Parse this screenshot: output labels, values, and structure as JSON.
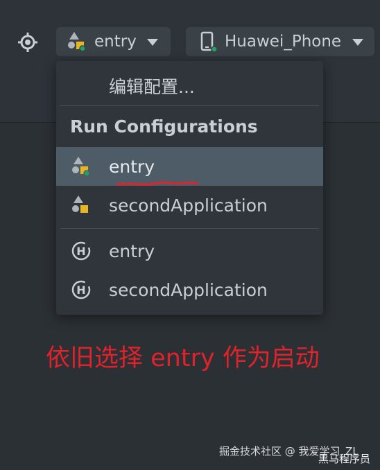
{
  "toolbar": {
    "target_icon": "crosshair-icon",
    "module_select": {
      "icon": "module-icon",
      "value": "entry",
      "caret": "caret-down-icon"
    },
    "device_select": {
      "icon": "phone-icon",
      "value": "Huawei_Phone",
      "caret": "caret-down-icon"
    }
  },
  "dropdown": {
    "edit_label": "编辑配置...",
    "section_header": "Run Configurations",
    "items": [
      {
        "label": "entry",
        "icon": "module-run-icon",
        "selected": true
      },
      {
        "label": "secondApplication",
        "icon": "module-icon",
        "selected": false
      },
      {
        "label": "entry",
        "icon": "harmony-h-icon",
        "selected": false
      },
      {
        "label": "secondApplication",
        "icon": "harmony-h-icon",
        "selected": false
      }
    ]
  },
  "annotation": {
    "text": "依旧选择 entry 作为启动",
    "color": "#e1222b"
  },
  "watermark": {
    "line1": "掘金技术社区 @ 我爱学习_ZL",
    "line2": "黑马程序员"
  },
  "colors": {
    "background": "#2b3035",
    "menu": "#2f353a",
    "selected": "#4e5c67",
    "text": "#c9cfd4",
    "accent_green": "#21a366",
    "accent_yellow": "#e8b622",
    "annotation_red": "#e1222b"
  }
}
